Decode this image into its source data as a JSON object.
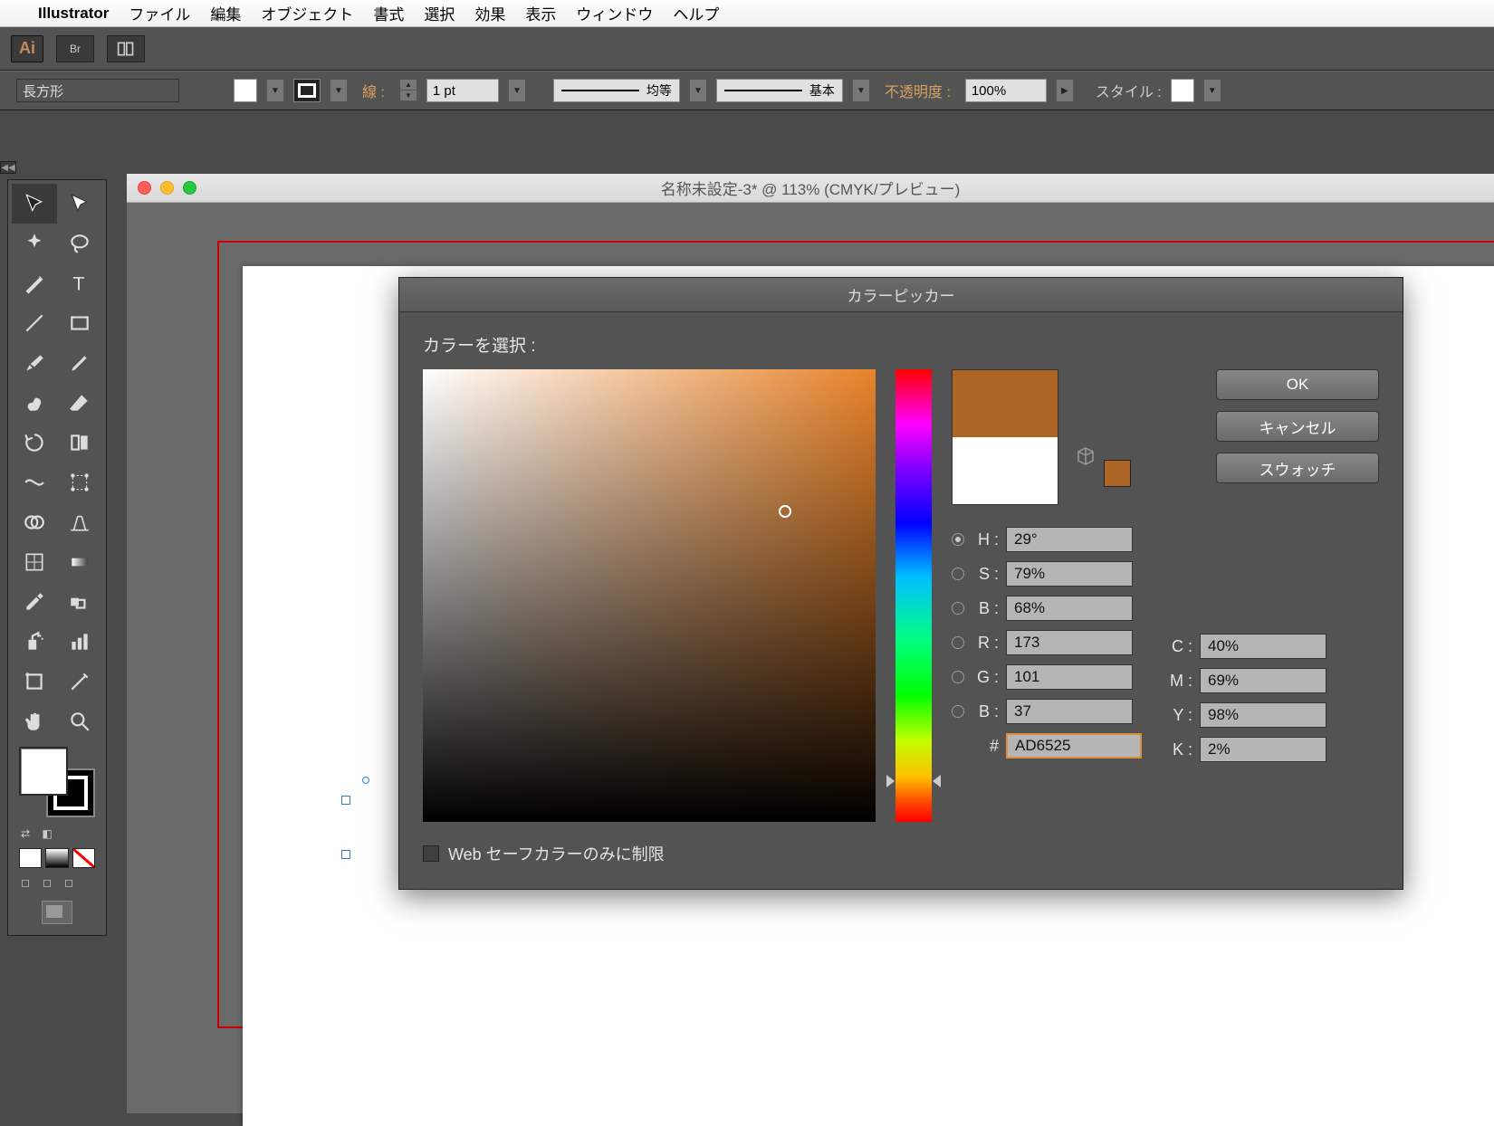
{
  "mac_menu": {
    "apple": "",
    "app": "Illustrator",
    "items": [
      "ファイル",
      "編集",
      "オブジェクト",
      "書式",
      "選択",
      "効果",
      "表示",
      "ウィンドウ",
      "ヘルプ"
    ]
  },
  "app_bar": {
    "logo": "Ai",
    "br": "Br"
  },
  "control": {
    "shape": "長方形",
    "stroke_label": "線 :",
    "stroke_width": "1 pt",
    "dash_label": "均等",
    "profile_label": "基本",
    "opacity_label": "不透明度 :",
    "opacity_value": "100%",
    "style_label": "スタイル :"
  },
  "doc": {
    "title": "名称未設定-3* @ 113% (CMYK/プレビュー)"
  },
  "picker": {
    "title": "カラーピッカー",
    "heading": "カラーを選択 :",
    "ok": "OK",
    "cancel": "キャンセル",
    "swatches": "スウォッチ",
    "hsb": {
      "H": "29°",
      "S": "79%",
      "B": "68%"
    },
    "rgb": {
      "R": "173",
      "G": "101",
      "B": "37"
    },
    "cmyk": {
      "C": "40%",
      "M": "69%",
      "Y": "98%",
      "K": "2%"
    },
    "hex": "AD6525",
    "websafe": "Web セーフカラーのみに制限",
    "hash": "#",
    "labels": {
      "H": "H :",
      "S": "S :",
      "Bhsb": "B :",
      "R": "R :",
      "G": "G :",
      "Brgb": "B :",
      "C": "C :",
      "M": "M :",
      "Y": "Y :",
      "K": "K :"
    }
  }
}
